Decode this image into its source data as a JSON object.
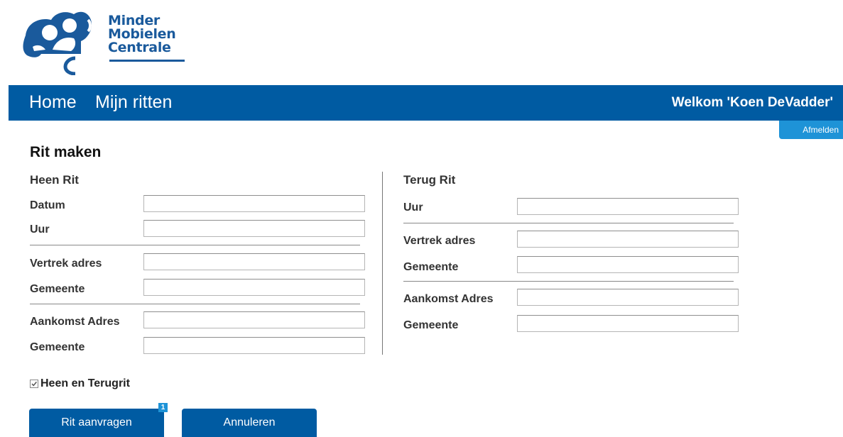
{
  "brand": {
    "line1": "Minder",
    "line2": "Mobielen",
    "line3": "Centrale",
    "color": "#1a5a9c"
  },
  "nav": {
    "home": "Home",
    "my_rides": "Mijn ritten",
    "welcome": "Welkom 'Koen DeVadder'",
    "logout": "Afmelden",
    "bar_color": "#005ba2"
  },
  "page": {
    "title": "Rit maken"
  },
  "outbound": {
    "title": "Heen Rit",
    "date_label": "Datum",
    "time_label": "Uur",
    "departure_label": "Vertrek adres",
    "departure_city_label": "Gemeente",
    "arrival_label": "Aankomst Adres",
    "arrival_city_label": "Gemeente"
  },
  "return": {
    "title": "Terug Rit",
    "time_label": "Uur",
    "departure_label": "Vertrek adres",
    "departure_city_label": "Gemeente",
    "arrival_label": "Aankomst Adres",
    "arrival_city_label": "Gemeente"
  },
  "round_trip": {
    "label": "Heen en Terugrit",
    "checked": true
  },
  "actions": {
    "request": "Rit aanvragen",
    "cancel": "Annuleren",
    "badge": "1"
  }
}
